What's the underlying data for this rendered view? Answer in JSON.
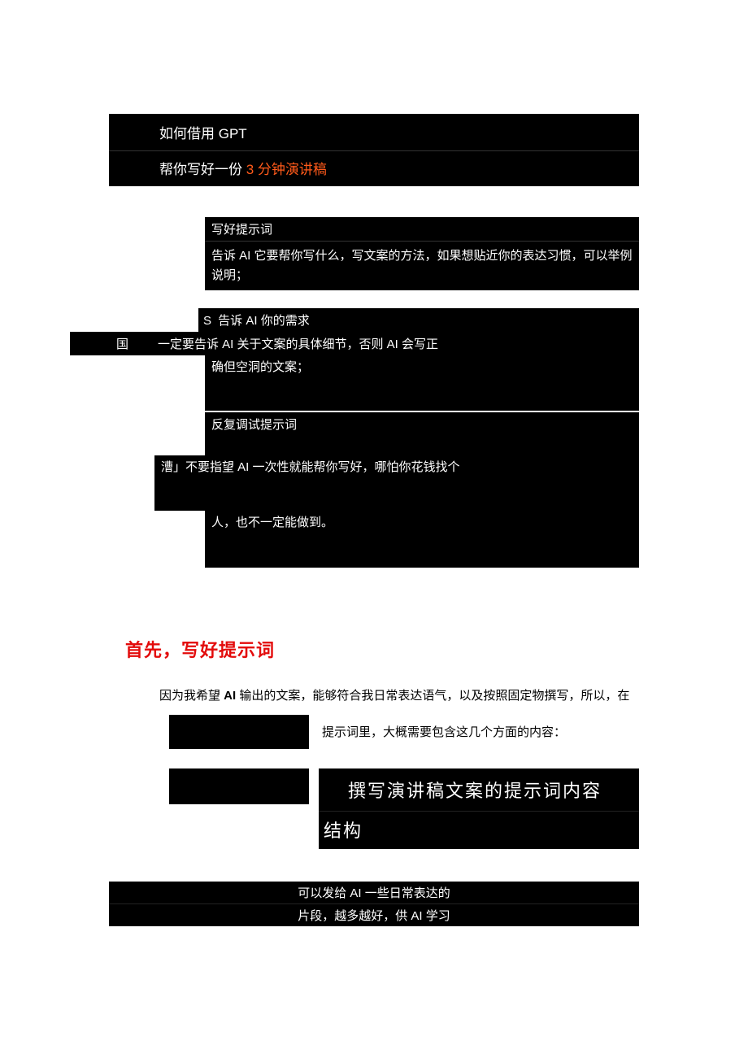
{
  "title": {
    "line1": "如何借用 GPT",
    "line2_prefix": "帮你写好一份 ",
    "line2_orange": "3 分钟演讲稿"
  },
  "steps": {
    "step1": {
      "heading": "写好提示词",
      "body": "告诉 AI 它要帮你写什么，写文案的方法，如果想贴近你的表达习惯，可以举例说明；"
    },
    "step2": {
      "s_label": "S",
      "heading": " 告诉 AI 你的需求",
      "guo": "国",
      "line2_rest": "一定要告诉 AI 关于文案的具体细节，否则 AI 会写正",
      "line3": "确但空洞的文案；"
    },
    "step3": {
      "heading": "反复调试提示词",
      "line2": "漕」不要指望 AI 一次性就能帮你写好，哪怕你花钱找个",
      "line3": "人，也不一定能做到。"
    }
  },
  "redHeading": "首先，写好提示词",
  "para1": {
    "prefix": "因为我希望 ",
    "bold": "AI",
    "suffix": " 输出的文案，能够符合我日常表达语气，以及按照固定物撰写，所以，在"
  },
  "afterSpacer": "提示词里，大概需要包含这几个方面的内容：",
  "bigBox": {
    "line1": "撰写演讲稿文案的提示词内容",
    "line2": "结构"
  },
  "footer": {
    "line1": "可以发给 AI 一些日常表达的",
    "line2": "片段，越多越好，供 AI 学习"
  }
}
